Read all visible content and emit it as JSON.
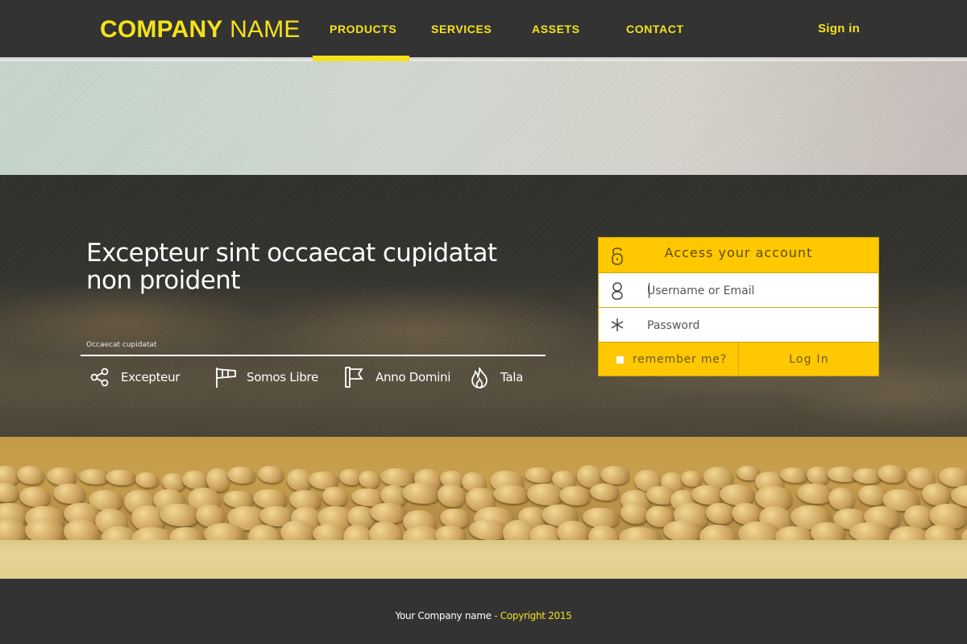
{
  "header": {
    "logo_bold": "COMPANY",
    "logo_light": "NAME",
    "nav": [
      {
        "label": "PRODUCTS",
        "active": true
      },
      {
        "label": "SERVICES",
        "active": false
      },
      {
        "label": "ASSETS",
        "active": false
      },
      {
        "label": "CONTACT",
        "active": false
      }
    ],
    "signin_label": "Sign in"
  },
  "hero": {
    "title": "Excepteur sint occaecat cupidatat non proident",
    "small_caption": "Occaecat cupidatat",
    "features": [
      {
        "label": "Excepteur",
        "icon": "share-icon"
      },
      {
        "label": "Somos Libre",
        "icon": "windsock-icon"
      },
      {
        "label": "Anno Domini",
        "icon": "flag-icon"
      },
      {
        "label": "Tala",
        "icon": "flame-icon"
      }
    ]
  },
  "login": {
    "title": "Access your account",
    "header_icon": "unlock-icon",
    "username_placeholder": "Username or Email",
    "username_icon": "user-icon",
    "password_placeholder": "Password",
    "password_icon": "asterisk-icon",
    "remember_label": "remember me?",
    "submit_label": "Log In"
  },
  "footer": {
    "company": "Your Company name",
    "copyright": "- Copyright 2015"
  },
  "colors": {
    "accent_yellow": "#f5e21b",
    "login_yellow": "#ffc800",
    "header_bg": "#333333"
  }
}
